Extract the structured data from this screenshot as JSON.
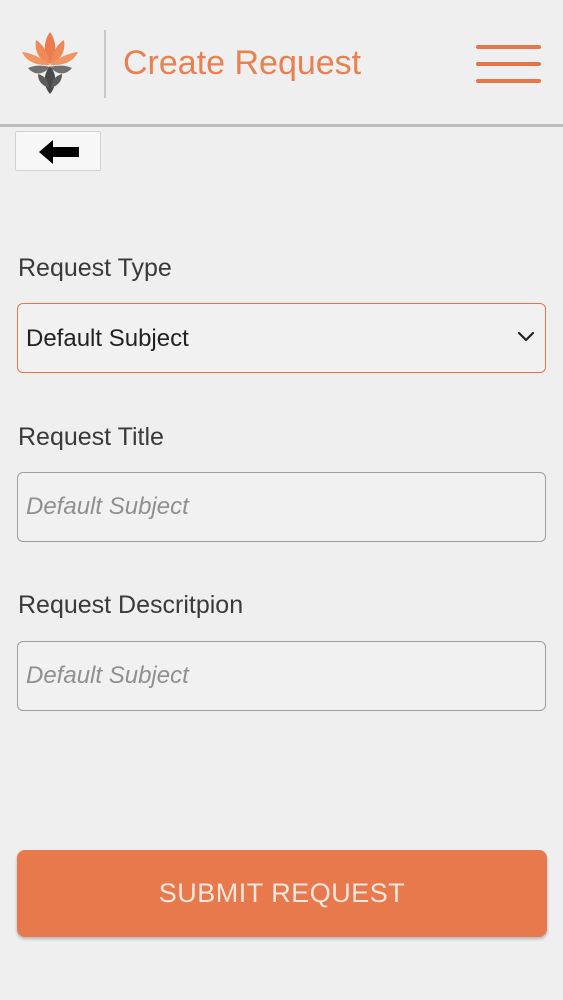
{
  "header": {
    "title": "Create Request",
    "logo_icon": "lotus-logo-icon",
    "menu_icon": "hamburger-menu-icon",
    "accent_color": "#e8804f"
  },
  "back_button": {
    "icon": "arrow-left-icon"
  },
  "form": {
    "request_type": {
      "label": "Request Type",
      "selected_value": "Default Subject",
      "icon": "chevron-down-icon"
    },
    "request_title": {
      "label": "Request Title",
      "placeholder": "Default Subject"
    },
    "request_description": {
      "label": "Request Descritpion",
      "placeholder": "Default Subject"
    },
    "submit_label": "SUBMIT REQUEST"
  },
  "colors": {
    "background": "#f0eff0",
    "primary": "#e8794d",
    "field_border": "#9d9d9d"
  }
}
